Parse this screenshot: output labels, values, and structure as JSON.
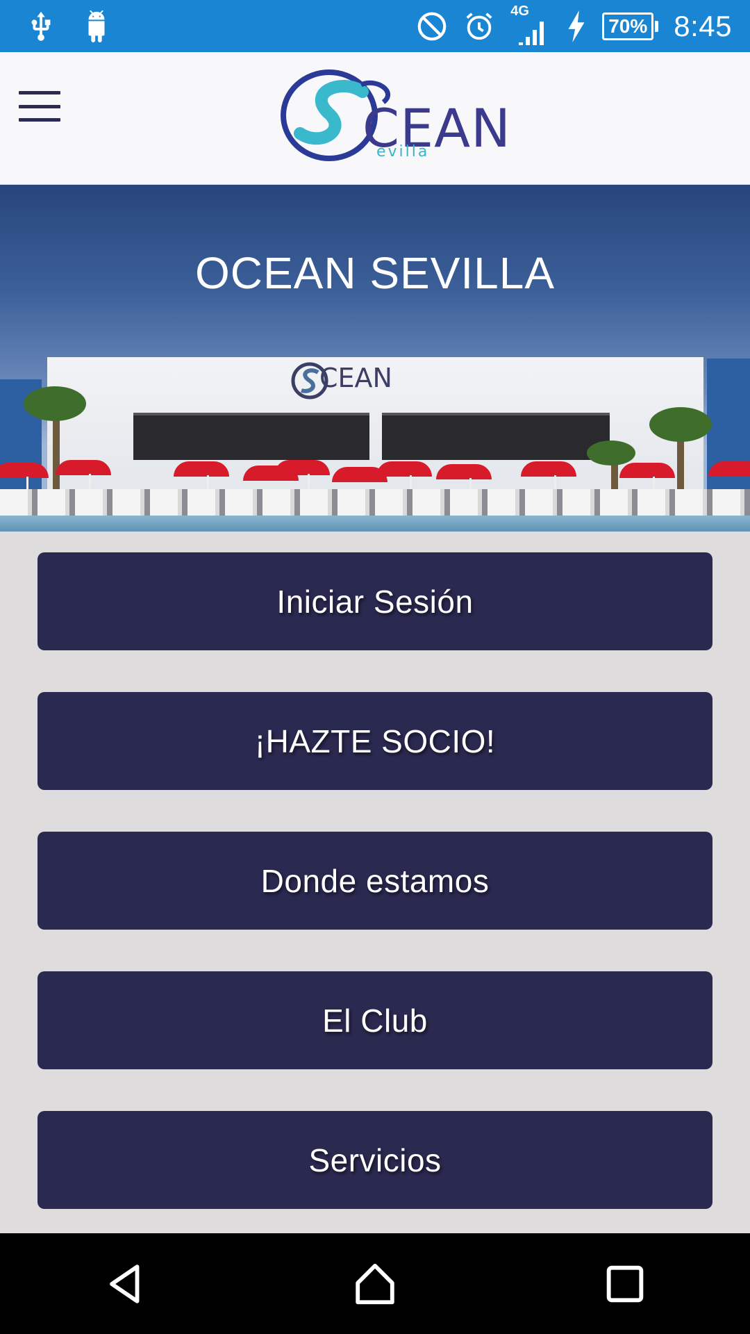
{
  "status_bar": {
    "network_type": "4G",
    "battery": "70%",
    "time": "8:45",
    "icons": [
      "usb-icon",
      "android-debug-icon",
      "do-not-disturb-icon",
      "alarm-icon",
      "signal-icon",
      "charging-icon",
      "battery-icon"
    ]
  },
  "app_bar": {
    "logo_word": "CEAN",
    "logo_sub": "evilla"
  },
  "hero": {
    "title": "OCEAN SEVILLA",
    "building_sign": "CEAN"
  },
  "menu": {
    "items": [
      {
        "label": "Iniciar Sesión"
      },
      {
        "label": "¡HAZTE SOCIO!"
      },
      {
        "label": "Donde estamos"
      },
      {
        "label": "El Club"
      },
      {
        "label": "Servicios"
      }
    ]
  },
  "colors": {
    "status_bar": "#1a86d3",
    "button": "#2a2950",
    "background": "#dedcdc",
    "app_bar": "#f8f8fa"
  }
}
